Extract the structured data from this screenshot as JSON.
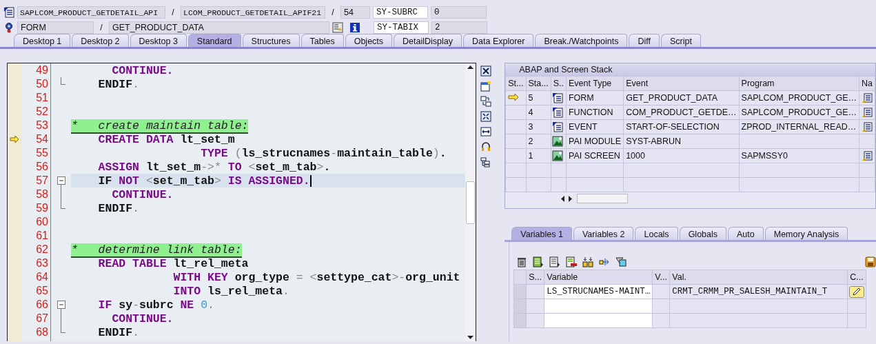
{
  "header": {
    "program": "SAPLCOM_PRODUCT_GETDETAIL_API",
    "include": "LCOM_PRODUCT_GETDETAIL_APIF21",
    "line": "54",
    "event_type": "FORM",
    "event": "GET_PRODUCT_DATA",
    "separators": [
      "/",
      "/",
      "/"
    ],
    "sy_fields": [
      {
        "name": "SY-SUBRC",
        "value": "0"
      },
      {
        "name": "SY-TABIX",
        "value": "2"
      }
    ]
  },
  "tabs": [
    {
      "label": "Desktop 1",
      "selected": false
    },
    {
      "label": "Desktop 2",
      "selected": false
    },
    {
      "label": "Desktop 3",
      "selected": false
    },
    {
      "label": "Standard",
      "selected": true
    },
    {
      "label": "Structures",
      "selected": false
    },
    {
      "label": "Tables",
      "selected": false
    },
    {
      "label": "Objects",
      "selected": false
    },
    {
      "label": "DetailDisplay",
      "selected": false
    },
    {
      "label": "Data Explorer",
      "selected": false
    },
    {
      "label": "Break./Watchpoints",
      "selected": false
    },
    {
      "label": "Diff",
      "selected": false
    },
    {
      "label": "Script",
      "selected": false
    }
  ],
  "editor": {
    "lines": [
      {
        "number": "49",
        "current": false,
        "cursor": false,
        "tokens": [
          {
            "kind": "kw",
            "text": "      CONTINUE."
          }
        ]
      },
      {
        "number": "50",
        "current": false,
        "cursor": false,
        "fold_end": true,
        "tokens": [
          {
            "kind": "id",
            "text": "    ENDIF"
          },
          {
            "kind": "op",
            "text": "."
          }
        ]
      },
      {
        "number": "51",
        "current": false,
        "cursor": false
      },
      {
        "number": "52",
        "current": false,
        "cursor": false
      },
      {
        "number": "53",
        "current": false,
        "cursor": false,
        "tokens": [
          {
            "kind": "cm",
            "text": "*   create maintain table:"
          }
        ]
      },
      {
        "number": "54",
        "current": true,
        "cursor": false,
        "tokens": [
          {
            "kind": "kw",
            "text": "    CREATE DATA "
          },
          {
            "kind": "id",
            "text": "lt_set_m"
          }
        ]
      },
      {
        "number": "55",
        "current": false,
        "cursor": false,
        "tokens": [
          {
            "kind": "kw",
            "text": "                   TYPE "
          },
          {
            "kind": "op",
            "text": "("
          },
          {
            "kind": "id",
            "text": "ls_strucnames"
          },
          {
            "kind": "op",
            "text": "-"
          },
          {
            "kind": "id",
            "text": "maintain_table"
          },
          {
            "kind": "op",
            "text": ")"
          },
          {
            "kind": "id",
            "text": "."
          }
        ]
      },
      {
        "number": "56",
        "current": false,
        "cursor": false,
        "tokens": [
          {
            "kind": "kw",
            "text": "    ASSIGN "
          },
          {
            "kind": "id",
            "text": "lt_set_m"
          },
          {
            "kind": "op",
            "text": "->*"
          },
          {
            "kind": "kw",
            "text": " TO "
          },
          {
            "kind": "op",
            "text": "<"
          },
          {
            "kind": "id",
            "text": "set_m_tab"
          },
          {
            "kind": "op",
            "text": ">"
          },
          {
            "kind": "id",
            "text": "."
          }
        ]
      },
      {
        "number": "57",
        "current": false,
        "cursor": true,
        "fold_start": true,
        "tokens": [
          {
            "kind": "id",
            "text": "    IF "
          },
          {
            "kind": "kw",
            "text": "NOT "
          },
          {
            "kind": "op",
            "text": "<"
          },
          {
            "kind": "id",
            "text": "set_m_tab"
          },
          {
            "kind": "op",
            "text": ">"
          },
          {
            "kind": "kw",
            "text": " IS ASSIGNED."
          }
        ]
      },
      {
        "number": "58",
        "current": false,
        "cursor": false,
        "fold_body": true,
        "tokens": [
          {
            "kind": "kw",
            "text": "      CONTINUE."
          }
        ]
      },
      {
        "number": "59",
        "current": false,
        "cursor": false,
        "fold_end": true,
        "tokens": [
          {
            "kind": "id",
            "text": "    ENDIF"
          },
          {
            "kind": "op",
            "text": "."
          }
        ]
      },
      {
        "number": "60",
        "current": false,
        "cursor": false
      },
      {
        "number": "61",
        "current": false,
        "cursor": false
      },
      {
        "number": "62",
        "current": false,
        "cursor": false,
        "tokens": [
          {
            "kind": "cm",
            "text": "*   determine link table:"
          }
        ]
      },
      {
        "number": "63",
        "current": false,
        "cursor": false,
        "tokens": [
          {
            "kind": "kw",
            "text": "    READ TABLE "
          },
          {
            "kind": "id",
            "text": "lt_rel_meta"
          }
        ]
      },
      {
        "number": "64",
        "current": false,
        "cursor": false,
        "tokens": [
          {
            "kind": "kw",
            "text": "               WITH KEY "
          },
          {
            "kind": "id",
            "text": "org_type "
          },
          {
            "kind": "op",
            "text": "= <"
          },
          {
            "kind": "id",
            "text": "settype_cat"
          },
          {
            "kind": "op",
            "text": ">-"
          },
          {
            "kind": "id",
            "text": "org_unit"
          }
        ]
      },
      {
        "number": "65",
        "current": false,
        "cursor": false,
        "tokens": [
          {
            "kind": "kw",
            "text": "               INTO "
          },
          {
            "kind": "id",
            "text": "ls_rel_meta"
          },
          {
            "kind": "op",
            "text": "."
          }
        ]
      },
      {
        "number": "66",
        "current": false,
        "cursor": false,
        "fold_start": true,
        "tokens": [
          {
            "kind": "kw",
            "text": "    IF "
          },
          {
            "kind": "id",
            "text": "sy"
          },
          {
            "kind": "op",
            "text": "-"
          },
          {
            "kind": "id",
            "text": "subrc "
          },
          {
            "kind": "kw",
            "text": "NE "
          },
          {
            "kind": "num",
            "text": "0"
          },
          {
            "kind": "op",
            "text": "."
          }
        ]
      },
      {
        "number": "67",
        "current": false,
        "cursor": false,
        "fold_body": true,
        "tokens": [
          {
            "kind": "kw",
            "text": "      CONTINUE."
          }
        ]
      },
      {
        "number": "68",
        "current": false,
        "cursor": false,
        "fold_end": true,
        "tokens": [
          {
            "kind": "id",
            "text": "    ENDIF"
          },
          {
            "kind": "op",
            "text": "."
          }
        ]
      }
    ]
  },
  "stack": {
    "title": "ABAP and Screen Stack",
    "columns": [
      "St...",
      "Sta...",
      "S..",
      "Event Type",
      "Event",
      "Program",
      "Na"
    ],
    "rows": [
      {
        "current": true,
        "stack_level": "5",
        "kind": "form",
        "event_type": "FORM",
        "event": "GET_PRODUCT_DATA",
        "program": "SAPLCOM_PRODUCT_GE…",
        "nav_icon": true
      },
      {
        "current": false,
        "stack_level": "4",
        "kind": "form",
        "event_type": "FUNCTION",
        "event": "COM_PRODUCT_GETDE…",
        "program": "SAPLCOM_PRODUCT_GE…",
        "nav_icon": true
      },
      {
        "current": false,
        "stack_level": "3",
        "kind": "form",
        "event_type": "EVENT",
        "event": "START-OF-SELECTION",
        "program": "ZPROD_INTERNAL_READ…",
        "nav_icon": true
      },
      {
        "current": false,
        "stack_level": "2",
        "kind": "screen",
        "event_type": "PAI MODULE",
        "event": "SYST-ABRUN",
        "nav_icon": false
      },
      {
        "current": false,
        "stack_level": "1",
        "kind": "screen",
        "event_type": "PAI SCREEN",
        "event": "1000",
        "program": "SAPMSSY0",
        "nav_icon": true
      }
    ]
  },
  "variables": {
    "tabs": [
      {
        "label": "Variables 1",
        "selected": true
      },
      {
        "label": "Variables 2",
        "selected": false
      },
      {
        "label": "Locals",
        "selected": false
      },
      {
        "label": "Globals",
        "selected": false
      },
      {
        "label": "Auto",
        "selected": false
      },
      {
        "label": "Memory Analysis",
        "selected": false
      }
    ],
    "columns": [
      "S...",
      "Variable",
      "V...",
      "Val.",
      "C..."
    ],
    "rows": [
      {
        "variable": "LS_STRUCNAMES-MAINT…",
        "value": "CRMT_CRMM_PR_SALESH_MAINTAIN_T"
      }
    ]
  }
}
